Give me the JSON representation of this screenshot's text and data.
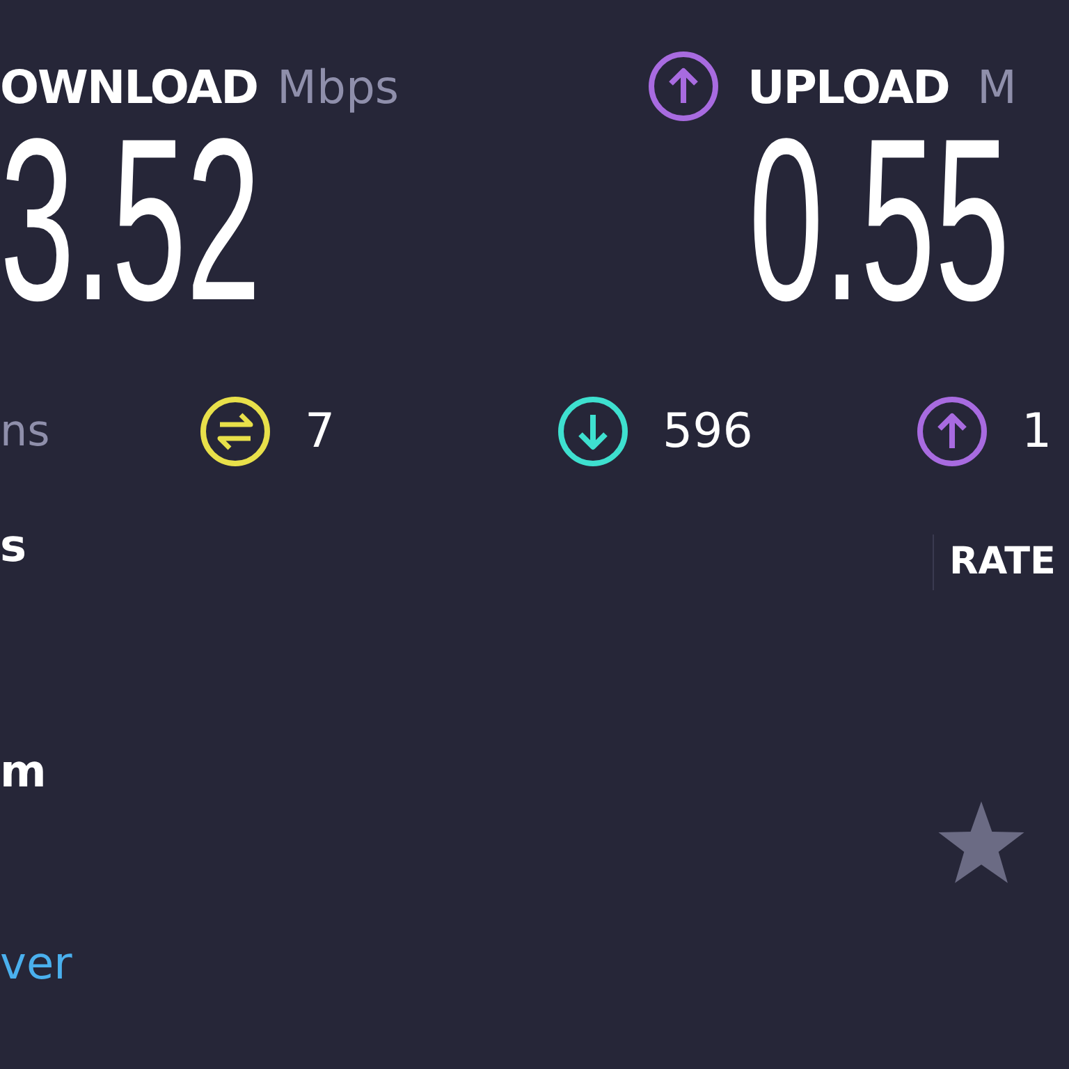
{
  "download": {
    "label": "OWNLOAD",
    "unit": "Mbps",
    "value": "3.52"
  },
  "upload": {
    "label": "UPLOAD",
    "unit": "M",
    "value": "0.55"
  },
  "stats_label": "ns",
  "stats": [
    {
      "kind": "ping",
      "value": "7"
    },
    {
      "kind": "download",
      "value": "596"
    },
    {
      "kind": "upload",
      "value": "1"
    }
  ],
  "details": [
    {
      "text": "s"
    },
    {
      "text": "m"
    }
  ],
  "server_link": "ver",
  "rating": {
    "label": "RATE"
  }
}
